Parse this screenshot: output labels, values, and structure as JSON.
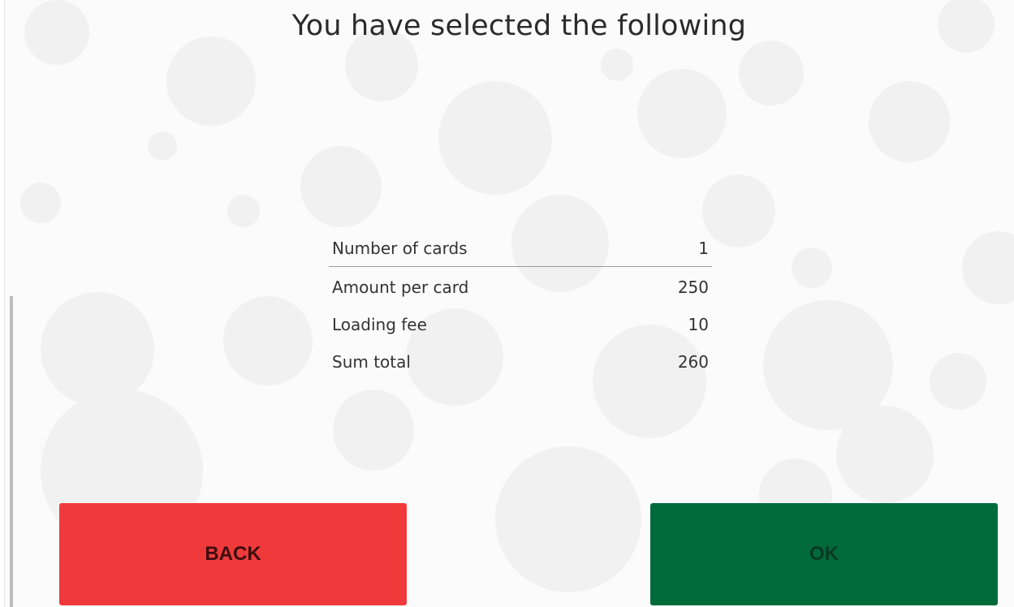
{
  "header": {
    "title": "You have selected the following"
  },
  "summary": {
    "rows": [
      {
        "label": "Number of cards",
        "value": "1"
      },
      {
        "label": "Amount per card",
        "value": "250"
      },
      {
        "label": "Loading fee",
        "value": "10"
      },
      {
        "label": "Sum total",
        "value": "260"
      }
    ]
  },
  "actions": {
    "back_label": "BACK",
    "ok_label": "OK",
    "back_color": "#f0393b",
    "ok_color": "#006a3b"
  }
}
